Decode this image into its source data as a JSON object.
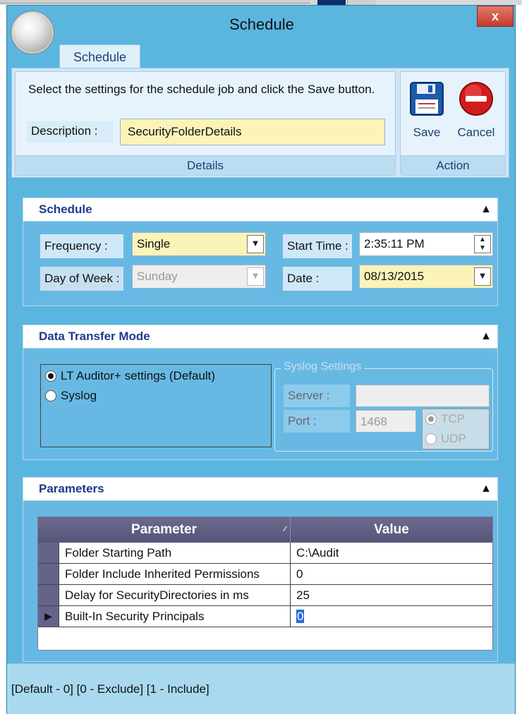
{
  "window": {
    "title": "Schedule",
    "close_glyph": "x"
  },
  "ribbon": {
    "tab": "Schedule",
    "instruction": "Select the settings for the schedule job and click the Save button.",
    "description_label": "Description :",
    "description_value": "SecurityFolderDetails",
    "details_group": "Details",
    "action_group": "Action",
    "save_label": "Save",
    "cancel_label": "Cancel"
  },
  "schedule": {
    "header": "Schedule",
    "frequency_label": "Frequency :",
    "frequency_value": "Single",
    "day_label": "Day of Week :",
    "day_value": "Sunday",
    "start_time_label": "Start Time :",
    "start_time_value": "2:35:11 PM",
    "date_label": "Date :",
    "date_value": "08/13/2015"
  },
  "transfer": {
    "header": "Data Transfer Mode",
    "option_lt": "LT Auditor+ settings  (Default)",
    "option_syslog": "Syslog",
    "syslog_group": "Syslog Settings",
    "server_label": "Server :",
    "server_value": "",
    "port_label": "Port :",
    "port_value": "1468",
    "tcp": "TCP",
    "udp": "UDP"
  },
  "parameters": {
    "header": "Parameters",
    "columns": [
      "Parameter",
      "Value"
    ],
    "rows": [
      {
        "name": "Folder Starting Path",
        "value": "C:\\Audit"
      },
      {
        "name": "Folder Include Inherited Permissions",
        "value": "0"
      },
      {
        "name": "Delay for SecurityDirectories in ms",
        "value": "25"
      },
      {
        "name": "Built-In Security Principals",
        "value": "0"
      }
    ]
  },
  "status": "[Default - 0] [0 - Exclude]  [1 - Include]",
  "colors": {
    "accent": "#5bb6df",
    "header_text": "#1e3a8a",
    "field_yellow": "#fbf3b8",
    "grid_header": "#5f5f84"
  }
}
